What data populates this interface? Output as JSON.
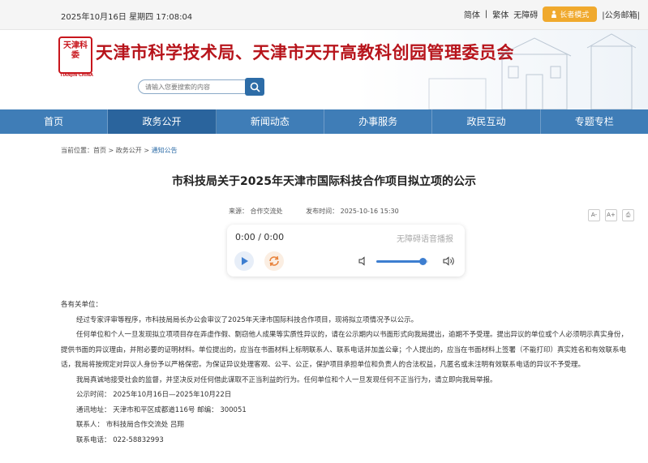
{
  "topbar": {
    "date": "2025年10月16日  星期四   17:08:04",
    "simplified": "简体",
    "traditional": "繁体",
    "accessibility": "无障碍",
    "elder_mode": "长者模式",
    "mail": "|公务邮箱|"
  },
  "header": {
    "logo_text": "天津科委",
    "logo_sub": "TIANJIN·CHINA",
    "site_title": "天津市科学技术局、天津市天开高教科创园管理委员会"
  },
  "search": {
    "placeholder": "请输入您要搜索的内容"
  },
  "nav": [
    {
      "label": "首页"
    },
    {
      "label": "政务公开"
    },
    {
      "label": "新闻动态"
    },
    {
      "label": "办事服务"
    },
    {
      "label": "政民互动"
    },
    {
      "label": "专题专栏"
    }
  ],
  "breadcrumb": {
    "prefix": "当前位置：",
    "home": "首页",
    "sep1": " > ",
    "section": "政务公开",
    "sep2": " > ",
    "current": "通知公告"
  },
  "article": {
    "title": "市科技局关于2025年天津市国际科技合作项目拟立项的公示",
    "source": "来源：  合作交流处",
    "published": "发布时间：  2025-10-16 15:30"
  },
  "tools": {
    "font_small": "A-",
    "font_large": "A+",
    "print": "⎙"
  },
  "player": {
    "time": "0:00 / 0:00",
    "label": "无障碍语音播报",
    "volume_level": 0.9
  },
  "body": {
    "salutation": "各有关单位：",
    "p1": "经过专家评审等程序，市科技局局长办公会审议了2025年天津市国际科技合作项目，现将拟立项情况予以公示。",
    "p2": "任何单位和个人一旦发现拟立项项目存在弄虚作假、剽窃他人成果等实质性异议的，请在公示期内以书面形式向我局提出，逾期不予受理。提出异议的单位或个人必须明示真实身份，提供书面的异议理由，并附必要的证明材料。单位提出的，应当在书面材料上标明联系人、联系电话并加盖公章；个人提出的，应当在书面材料上签署（不能打印）真实姓名和有效联系电话，我局将按规定对异议人身份予以严格保密。为保证异议处理客观、公平、公正，保护项目承担单位和负责人的合法权益，凡匿名或未注明有效联系电话的异议不予受理。",
    "p3": "我局真诚地接受社会的监督，并坚决反对任何借此谋取不正当利益的行为。任何单位和个人一旦发现任何不正当行为，请立即向我局举报。",
    "period": "公示时间：  2025年10月16日—2025年10月22日",
    "address": "通讯地址：  天津市和平区成都道116号    邮编：  300051",
    "contact": "联系人：  市科技局合作交流处    吕翔",
    "phone": "联系电话：  022-58832993"
  }
}
